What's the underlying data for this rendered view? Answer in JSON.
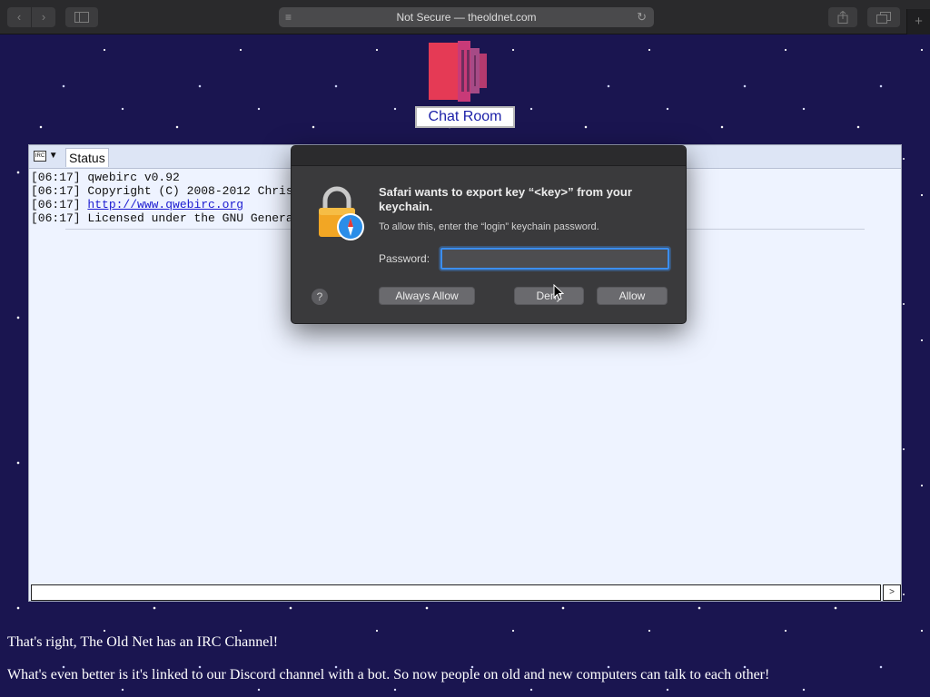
{
  "browser": {
    "address": "Not Secure — theoldnet.com",
    "icons": {
      "back": "chevron-left-icon",
      "forward": "chevron-right-icon",
      "sidebar": "sidebar-icon",
      "reader": "reader-icon",
      "reload": "reload-icon",
      "share": "share-icon",
      "tabs": "tabs-icon",
      "new_tab": "plus-icon"
    },
    "glyphs": {
      "back": "‹",
      "forward": "›",
      "reader": "≡",
      "reload": "↻",
      "new_tab": "+"
    }
  },
  "page": {
    "chat_title": "Chat Room",
    "paragraph1": "That's right, The Old Net has an IRC Channel!",
    "paragraph2": "What's even better is it's linked to our Discord channel with a bot. So now people on old and new computers can talk to each other!"
  },
  "irc": {
    "menu_logo": "IRC",
    "menu_arrow": "▼",
    "tab_label": "Status",
    "lines": [
      {
        "time": "[06:17]",
        "text": "qwebirc v0.92"
      },
      {
        "time": "[06:17]",
        "text": "Copyright (C) 2008-2012 Chris"
      },
      {
        "time": "[06:17]",
        "link": "http://www.qwebirc.org"
      },
      {
        "time": "[06:17]",
        "text": "Licensed under the GNU Genera"
      }
    ],
    "send_label": ">"
  },
  "dialog": {
    "heading": "Safari wants to export key “<key>” from your keychain.",
    "subtext": "To allow this, enter the “login” keychain password.",
    "password_label": "Password:",
    "password_value": "",
    "help_label": "?",
    "always_allow_label": "Always Allow",
    "deny_label": "Deny",
    "allow_label": "Allow"
  },
  "colors": {
    "page_background": "#1a1550",
    "dialog_background": "#3a3a3c",
    "focus_ring": "#3b8ef0",
    "link": "#1b1bd1",
    "logo": "#e53a55"
  }
}
